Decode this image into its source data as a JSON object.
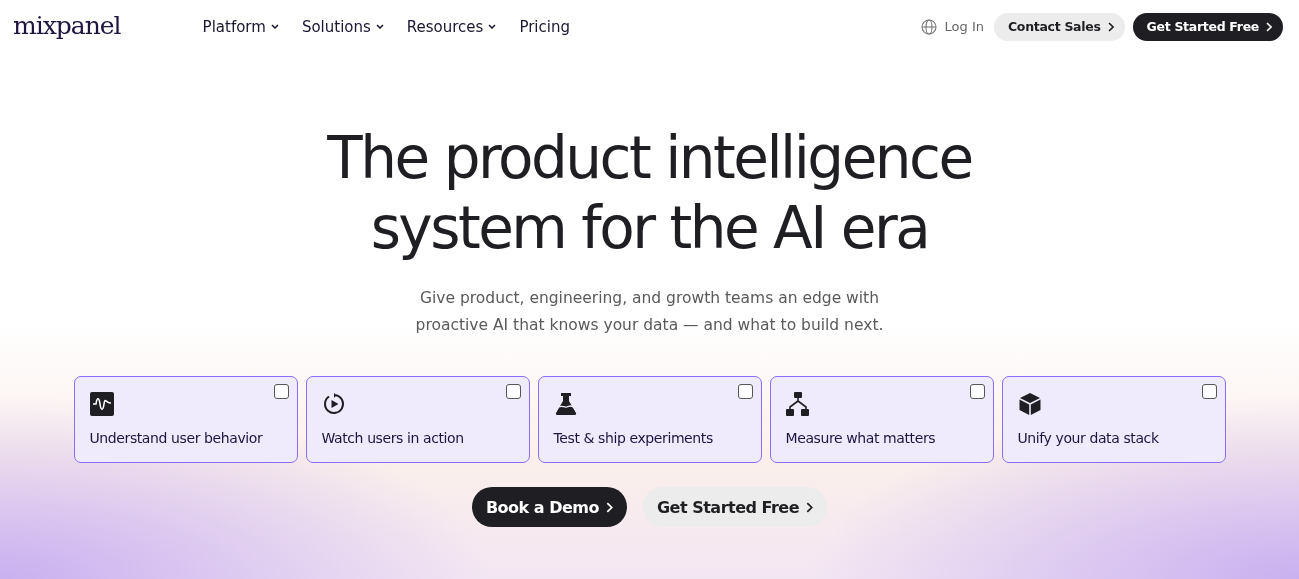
{
  "logo": "mixpanel",
  "nav": [
    {
      "label": "Platform",
      "has_menu": true
    },
    {
      "label": "Solutions",
      "has_menu": true
    },
    {
      "label": "Resources",
      "has_menu": true
    },
    {
      "label": "Pricing",
      "has_menu": false
    }
  ],
  "login": "Log In",
  "contact_button": "Contact Sales",
  "cta_button": "Get Started Free",
  "headline": "The product intelligence system for the AI era",
  "subtitle": "Give product, engineering, and growth teams an edge with proactive AI that knows your data — and what to build next.",
  "cards": [
    {
      "kind": "wave",
      "label": "Understand user behavior",
      "checked": false
    },
    {
      "kind": "replay",
      "label": "Watch users in action",
      "checked": false
    },
    {
      "kind": "flask",
      "label": "Test & ship experiments",
      "checked": false
    },
    {
      "kind": "tree",
      "label": "Measure what matters",
      "checked": false
    },
    {
      "kind": "cube",
      "label": "Unify your data stack",
      "checked": false
    }
  ],
  "demo_button": "Book a Demo",
  "start_button": "Get Started Free"
}
